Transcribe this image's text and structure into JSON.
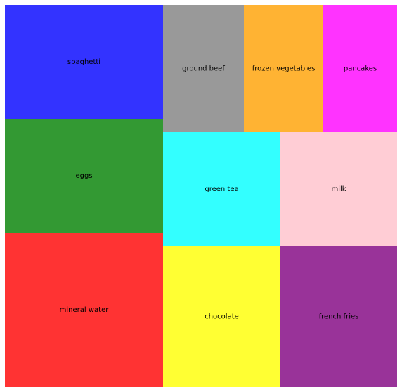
{
  "chart_data": {
    "type": "treemap",
    "title": "",
    "items": [
      {
        "label": "spaghetti",
        "color": "#3333ff"
      },
      {
        "label": "eggs",
        "color": "#339933"
      },
      {
        "label": "mineral water",
        "color": "#ff3333"
      },
      {
        "label": "ground beef",
        "color": "#999999"
      },
      {
        "label": "frozen vegetables",
        "color": "#ffb333"
      },
      {
        "label": "pancakes",
        "color": "#ff33ff"
      },
      {
        "label": "green tea",
        "color": "#33ffff"
      },
      {
        "label": "milk",
        "color": "#ffcdd5"
      },
      {
        "label": "chocolate",
        "color": "#ffff33"
      },
      {
        "label": "french fries",
        "color": "#993399"
      }
    ]
  }
}
